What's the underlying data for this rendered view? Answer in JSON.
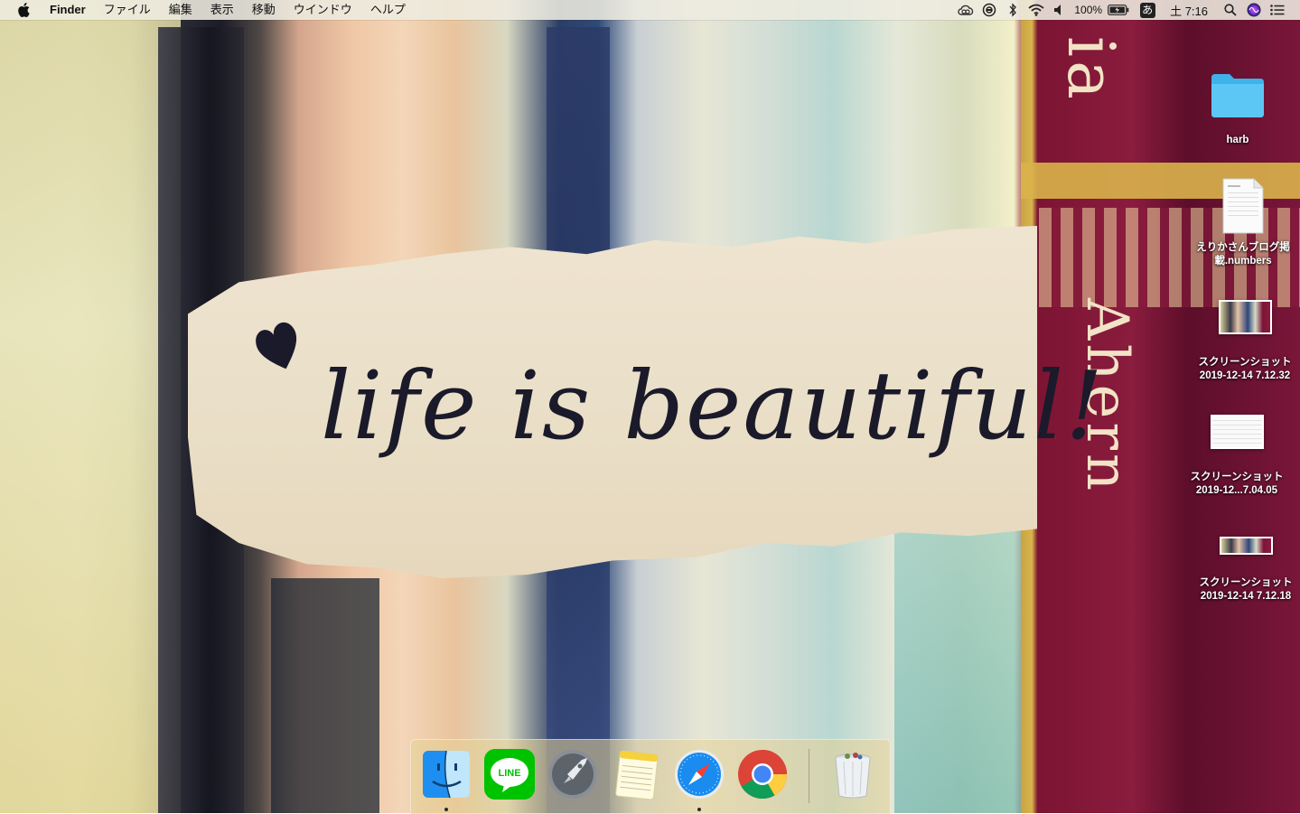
{
  "menubar": {
    "app_name": "Finder",
    "menus": [
      "ファイル",
      "編集",
      "表示",
      "移動",
      "ウインドウ",
      "ヘルプ"
    ],
    "battery_percent": "100%",
    "input_method": "あ",
    "clock": "土 7:16"
  },
  "wallpaper": {
    "note_text": "life is beautiful!",
    "book_spine_top": "ia",
    "book_spine_bottom": "Ahern"
  },
  "desktop_items": [
    {
      "label_line1": "harb",
      "label_line2": "",
      "icon": "folder-icon"
    },
    {
      "label_line1": "えりかさんブログ掲",
      "label_line2": "載.numbers",
      "icon": "numbers-document-icon"
    },
    {
      "label_line1": "スクリーンショット",
      "label_line2": "2019-12-14 7.12.32",
      "icon": "screenshot-thumbnail"
    },
    {
      "label_line1": "スクリーンショット",
      "label_line2": "2019-12...7.04.05",
      "icon": "screenshot-thumbnail"
    },
    {
      "label_line1": "スクリーンショット",
      "label_line2": "2019-12-14 7.12.18",
      "icon": "screenshot-thumbnail"
    }
  ],
  "dock": {
    "apps": [
      {
        "name": "finder-icon",
        "running": true
      },
      {
        "name": "line-icon",
        "running": false,
        "label": "LINE"
      },
      {
        "name": "launchpad-icon",
        "running": false
      },
      {
        "name": "notes-icon",
        "running": false
      },
      {
        "name": "safari-icon",
        "running": true
      },
      {
        "name": "chrome-icon",
        "running": false
      },
      {
        "name": "trash-icon",
        "running": false
      }
    ]
  },
  "colors": {
    "folder_blue": "#5cc6f5",
    "line_green": "#00c300",
    "menubar_bg": "#eeece0"
  }
}
